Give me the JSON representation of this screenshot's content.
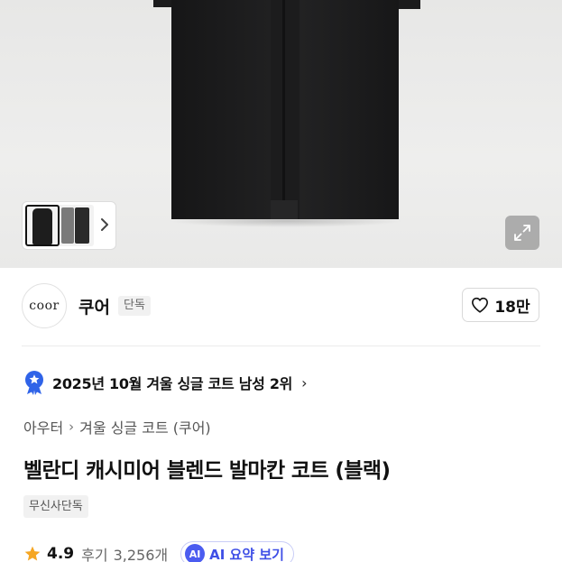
{
  "hero": {
    "thumbnail_next_icon": "chevron-right-icon",
    "expand_icon": "expand-arrows-icon"
  },
  "brand": {
    "logo_text": "coor",
    "name": "쿠어",
    "badge": "단독",
    "like_icon": "heart-outline-icon",
    "like_count": "18만"
  },
  "ranking": {
    "icon": "ranking-medal-icon",
    "text": "2025년 10월 겨울 싱글 코트 남성 2위",
    "chevron": "›"
  },
  "breadcrumb": {
    "items": [
      "아우터",
      "겨울 싱글 코트 (쿠어)"
    ],
    "separator": "›"
  },
  "product": {
    "title": "벨란디 캐시미어 블렌드 발마칸 코트 (블랙)",
    "exclusive_badge": "무신사단독"
  },
  "rating": {
    "star_icon": "star-icon",
    "score": "4.9",
    "review_label": "후기",
    "review_count": "3,256개",
    "ai_icon_text": "AI",
    "ai_button_label": "AI 요약 보기"
  },
  "colors": {
    "accent_blue": "#3f4fe6",
    "rank_badge_blue": "#2f63e8",
    "star_orange": "#f5a623"
  }
}
